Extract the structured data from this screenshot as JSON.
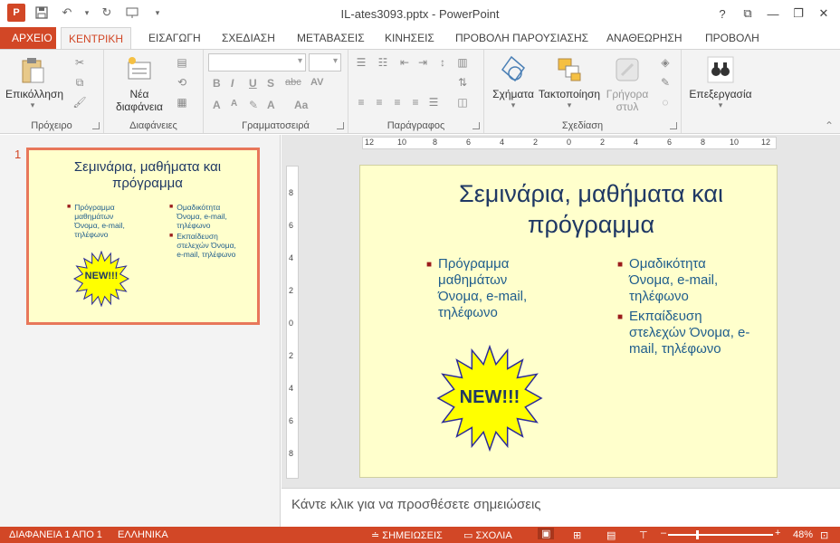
{
  "window": {
    "title": "IL-ates3093.pptx - PowerPoint"
  },
  "tabs": [
    {
      "label": "ΑΡΧΕΙΟ"
    },
    {
      "label": "ΚΕΝΤΡΙΚΗ"
    },
    {
      "label": "ΕΙΣΑΓΩΓΗ"
    },
    {
      "label": "ΣΧΕΔΙΑΣΗ"
    },
    {
      "label": "ΜΕΤΑΒΑΣΕΙΣ"
    },
    {
      "label": "ΚΙΝΗΣΕΙΣ"
    },
    {
      "label": "ΠΡΟΒΟΛΗ ΠΑΡΟΥΣΙΑΣΗΣ"
    },
    {
      "label": "ΑΝΑΘΕΩΡΗΣΗ"
    },
    {
      "label": "ΠΡΟΒΟΛΗ"
    }
  ],
  "ribbon": {
    "clipboard": {
      "paste": "Επικόλληση",
      "label": "Πρόχειρο"
    },
    "slides": {
      "new_slide_1": "Νέα",
      "new_slide_2": "διαφάνεια",
      "label": "Διαφάνειες"
    },
    "font": {
      "label": "Γραμματοσειρά"
    },
    "paragraph": {
      "label": "Παράγραφος"
    },
    "drawing": {
      "shapes": "Σχήματα",
      "arrange": "Τακτοποίηση",
      "quick_styles_1": "Γρήγορα",
      "quick_styles_2": "στυλ",
      "label": "Σχεδίαση"
    },
    "editing": {
      "label": "Επεξεργασία"
    }
  },
  "thumbnail": {
    "number": "1"
  },
  "slide": {
    "title": "Σεμινάρια, μαθήματα και πρόγραμμα",
    "left_bullet": "Πρόγραμμα μαθημάτων Όνομα, e-mail, τηλέφωνο",
    "right_bullets": [
      "Ομαδικότητα Όνομα, e-mail, τηλέφωνο",
      "Εκπαίδευση στελεχών Όνομα, e-mail, τηλέφωνο"
    ],
    "starburst": "NEW!!!"
  },
  "rulers": {
    "horizontal": [
      "12",
      "10",
      "8",
      "6",
      "4",
      "2",
      "0",
      "2",
      "4",
      "6",
      "8",
      "10",
      "12"
    ],
    "vertical": [
      "8",
      "6",
      "4",
      "2",
      "0",
      "2",
      "4",
      "6",
      "8"
    ]
  },
  "notes": {
    "placeholder": "Κάντε κλικ για να προσθέσετε σημειώσεις"
  },
  "status": {
    "slide_info": "ΔΙΑΦΑΝΕΙΑ 1 ΑΠΟ 1",
    "language": "ΕΛΛΗΝΙΚΑ",
    "notes_btn": "ΣΗΜΕΙΩΣΕΙΣ",
    "comments_btn": "ΣΧΟΛΙΑ",
    "zoom": "48%"
  },
  "colors": {
    "accent": "#d24726",
    "slide_bg": "#ffffcc",
    "title": "#1f3864",
    "body": "#1f5d8c",
    "bullet": "#9b1b1b"
  }
}
